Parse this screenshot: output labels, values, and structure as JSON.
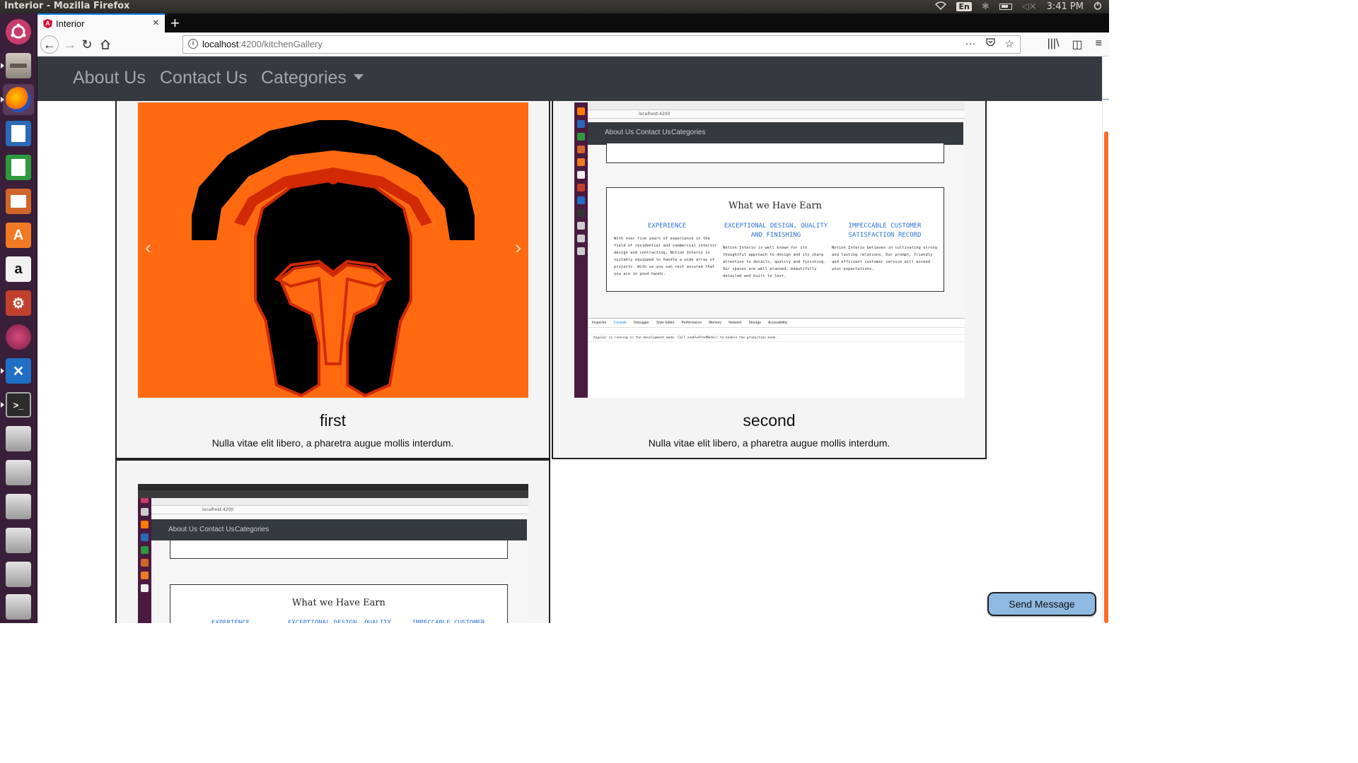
{
  "system_bar": {
    "window_title": "Interior - Mozilla Firefox",
    "keyboard_layout": "En",
    "clock": "3:41 PM"
  },
  "launcher": {
    "icons": [
      "ubuntu-dash-icon",
      "files-icon",
      "firefox-icon",
      "writer-icon",
      "calc-icon",
      "impress-icon",
      "software-center-icon",
      "amazon-icon",
      "system-settings-icon",
      "app-icon",
      "vscode-icon",
      "terminal-icon",
      "drive-icon",
      "drive-icon",
      "drive-icon",
      "drive-icon",
      "drive-icon",
      "drive-icon"
    ]
  },
  "browser": {
    "tab_title": "Interior",
    "tab_favicon": "A",
    "url_host": "localhost",
    "url_rest": ":4200/kitchenGallery",
    "accent": "#0a84ff"
  },
  "app_nav": {
    "items": [
      "About Us",
      "Contact Us",
      "Categories"
    ]
  },
  "gallery": {
    "cards": [
      {
        "title": "first",
        "text": "Nulla vitae elit libero, a pharetra augue mollis interdum."
      },
      {
        "title": "second",
        "text": "Nulla vitae elit libero, a pharetra augue mollis interdum."
      }
    ],
    "carousel_prev": "‹",
    "carousel_next": "›"
  },
  "embedded_shot": {
    "nav": [
      "About Us",
      "Contact Us",
      "Categories"
    ],
    "url": "localhost:4200",
    "heading": "What we Have Earn",
    "columns": [
      {
        "heading": "EXPERIENCE",
        "body": "With over five years of experience in the field of residential and commercial interior design and contracting, Notion Interio is suitably equipped to handle a wide array of projects. With us you can rest assured that you are in good hands."
      },
      {
        "heading": "EXCEPTIONAL DESIGN, QUALITY AND FINISHING",
        "body": "Notion Interio is well known for its thoughtful approach to design and its sharp attention to details, quality and finishing. Our spaces are well planned, beautifully detailed and built to last."
      },
      {
        "heading": "IMPECCABLE CUSTOMER SATISFACTION RECORD",
        "body": "Notion Interio believes in cultivating strong and lasting relations. Our prompt, friendly and efficient customer service will exceed your expectations."
      }
    ],
    "devtools_tabs": [
      "Inspector",
      "Console",
      "Debugger",
      "Style Editor",
      "Performance",
      "Memory",
      "Network",
      "Storage",
      "Accessibility"
    ],
    "console_line": "Angular is running in the development mode. Call enableProdMode() to enable the production mode."
  },
  "send_message": "Send Message",
  "colors": {
    "nav_bg": "#343a40",
    "helmet_bg": "#ff6a10",
    "send_bg": "#8fb9e0"
  }
}
